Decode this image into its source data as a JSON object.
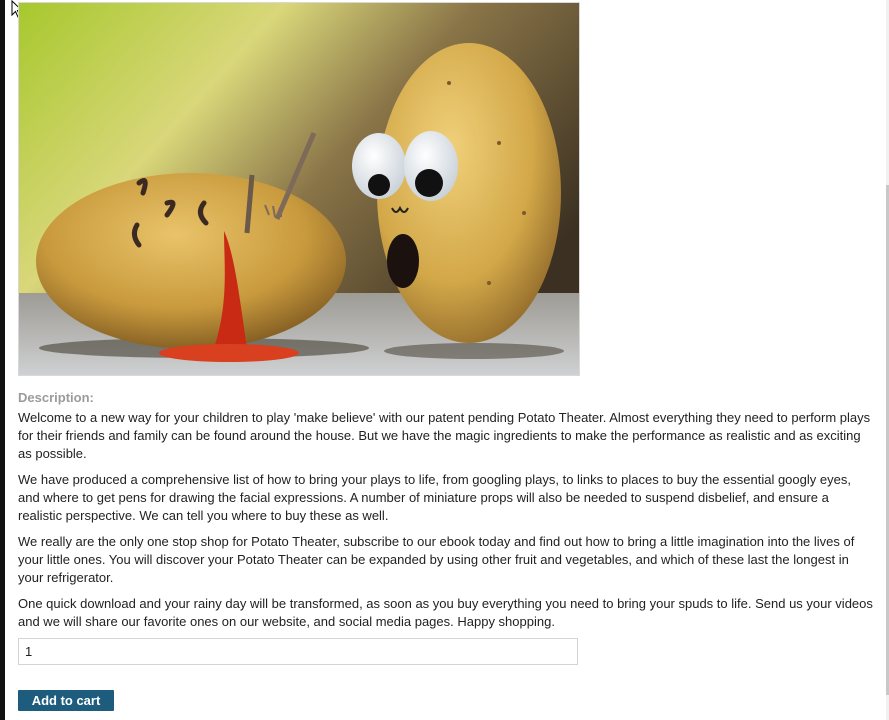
{
  "product": {
    "image_alt": "Potato Theater product image",
    "description_label": "Description:",
    "paragraphs": [
      "Welcome to a new way for your children to play 'make believe' with our patent pending Potato Theater. Almost everything they need to perform plays for their friends and family can be found around the house. But we have the magic ingredients to make the performance as realistic and as exciting as possible.",
      "We have produced a comprehensive list of how to bring your plays to life, from googling plays, to links to places to buy the essential googly eyes, and where to get pens for drawing the facial expressions. A number of miniature props will also be needed to suspend disbelief, and ensure a realistic perspective. We can tell you where to buy these as well.",
      "We really are the only one stop shop for Potato Theater, subscribe to our ebook today and find out how to bring a little imagination into the lives of your little ones. You will discover your Potato Theater can be expanded by using other fruit and vegetables, and which of these last the longest in your refrigerator.",
      "One quick download and your rainy day will be transformed, as soon as you buy everything you need to bring your spuds to life. Send us your videos and we will share our favorite ones on our website, and social media pages. Happy shopping."
    ]
  },
  "quantity": {
    "value": "1"
  },
  "add_to_cart_label": "Add to cart",
  "colors": {
    "button_bg": "#1e5c7d",
    "label_gray": "#9b9b9b",
    "text": "#222222"
  }
}
